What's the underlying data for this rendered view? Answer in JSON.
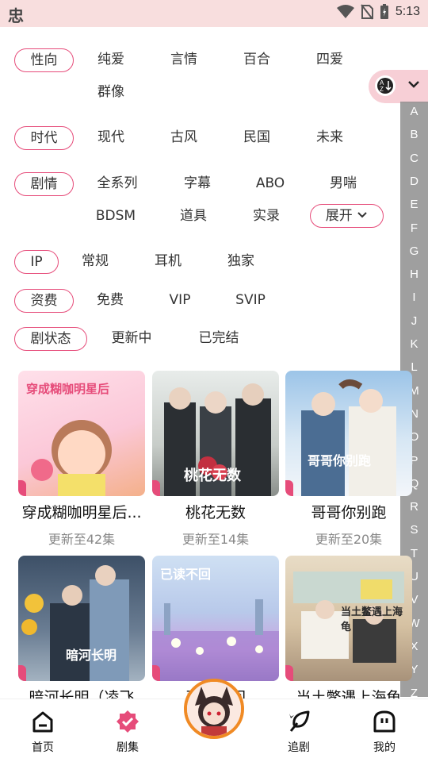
{
  "status_bar": {
    "app_glyph": "忠",
    "time": "5:13"
  },
  "filters": {
    "orientation": {
      "label": "性向",
      "options": [
        "纯爱",
        "言情",
        "百合",
        "四爱",
        "群像"
      ]
    },
    "era": {
      "label": "时代",
      "options": [
        "现代",
        "古风",
        "民国",
        "未来"
      ]
    },
    "plot": {
      "label": "剧情",
      "options": [
        "全系列",
        "字幕",
        "ABO",
        "男喘",
        "BDSM",
        "道具",
        "实录"
      ],
      "expand_label": "展开"
    },
    "ip": {
      "label": "IP",
      "options": [
        "常规",
        "耳机",
        "独家"
      ]
    },
    "fee": {
      "label": "资费",
      "options": [
        "免费",
        "VIP",
        "SVIP"
      ]
    },
    "status": {
      "label": "剧状态",
      "options": [
        "更新中",
        "已完结"
      ]
    }
  },
  "alpha_index": [
    "A",
    "B",
    "C",
    "D",
    "E",
    "F",
    "G",
    "H",
    "I",
    "J",
    "K",
    "L",
    "M",
    "N",
    "O",
    "P",
    "Q",
    "R",
    "S",
    "T",
    "U",
    "V",
    "W",
    "X",
    "Y",
    "Z"
  ],
  "dramas": [
    {
      "title": "穿成糊咖明星后...",
      "subtitle": "更新至42集",
      "cover_text": "穿成糊咖明星后"
    },
    {
      "title": "桃花无数",
      "subtitle": "更新至14集",
      "cover_text": "桃花无数"
    },
    {
      "title": "哥哥你别跑",
      "subtitle": "更新至20集",
      "cover_text": "哥哥你别跑"
    },
    {
      "title": "暗河长明（凌飞",
      "subtitle": "",
      "cover_text": "暗河长明"
    },
    {
      "title": "已读不回",
      "subtitle": "",
      "cover_text": "已读不回"
    },
    {
      "title": "当土鳖遇上海龟",
      "subtitle": "",
      "cover_text": "当土鳖遇上海龟"
    }
  ],
  "tabbar": {
    "home": "首页",
    "series": "剧集",
    "follow": "追剧",
    "mine": "我的"
  },
  "colors": {
    "accent": "#e64c7a",
    "status_bar": "#f8dede",
    "index_bar": "#8f8f8f",
    "avatar_ring": "#f08a24"
  }
}
